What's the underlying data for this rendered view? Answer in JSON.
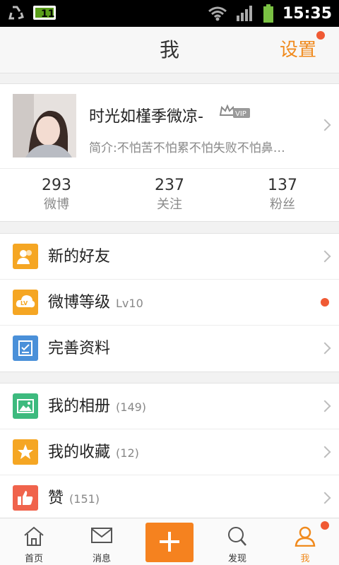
{
  "status_bar": {
    "time": "15:35"
  },
  "header": {
    "title": "我",
    "settings_label": "设置"
  },
  "profile": {
    "name": "时光如槿季微凉-",
    "vip_badge": "VIP",
    "bio": "简介:不怕苦不怕累不怕失败不怕鼻…"
  },
  "stats": [
    {
      "value": "293",
      "label": "微博"
    },
    {
      "value": "237",
      "label": "关注"
    },
    {
      "value": "137",
      "label": "粉丝"
    }
  ],
  "menu_group1": [
    {
      "label": "新的好友",
      "sub": "",
      "icon": "friends-icon"
    },
    {
      "label": "微博等级",
      "sub": "Lv10",
      "icon": "level-icon"
    },
    {
      "label": "完善资料",
      "sub": "",
      "icon": "edit-profile-icon"
    }
  ],
  "menu_group2": [
    {
      "label": "我的相册",
      "sub": "(149)",
      "icon": "album-icon"
    },
    {
      "label": "我的收藏",
      "sub": "(12)",
      "icon": "star-icon"
    },
    {
      "label": "赞",
      "sub": "(151)",
      "icon": "thumbs-up-icon"
    }
  ],
  "tabbar": {
    "home": "首页",
    "messages": "消息",
    "discover": "发现",
    "me": "我"
  },
  "colors": {
    "accent": "#f08a1d",
    "badge": "#f05a34",
    "compose": "#f5821f"
  }
}
